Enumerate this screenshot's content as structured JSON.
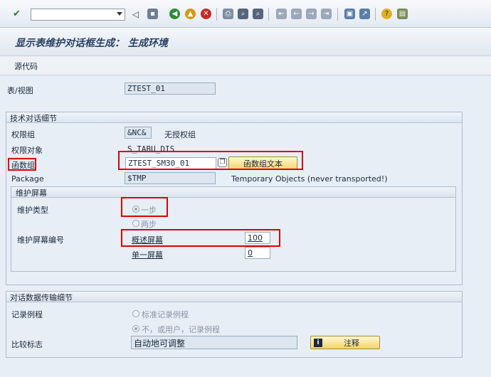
{
  "toolbar": {
    "command_field_value": "",
    "icons": [
      "enter-check-icon",
      "command-field",
      "save-icon",
      "back-icon",
      "exit-icon",
      "cancel-icon",
      "print-icon",
      "find-icon",
      "find-next-icon",
      "first-page-icon",
      "previous-page-icon",
      "next-page-icon",
      "last-page-icon",
      "create-session-icon",
      "create-shortcut-icon",
      "help-icon",
      "customize-layout-icon"
    ]
  },
  "title": "显示表维护对话框生成： 生成环境",
  "subtoolbar": {
    "source_code": "源代码"
  },
  "table_view": {
    "label": "表/视图",
    "value": "ZTEST_01"
  },
  "tech_details": {
    "header": "技术对话细节",
    "auth_group_label": "权限组",
    "auth_group_value": "&NC&",
    "auth_group_desc": "无授权组",
    "auth_object_label": "权限对象",
    "auth_object_value": "S_TABU_DIS",
    "function_group_label": "函数组",
    "function_group_value": "ZTEST_SM30_01",
    "function_group_text_button": "函数组文本",
    "package_label": "Package",
    "package_value": "$TMP",
    "package_desc": "Temporary Objects (never transported!)"
  },
  "maint_screen": {
    "header": "维护屏幕",
    "type_label": "维护类型",
    "one_step": "一步",
    "two_step": "两步",
    "screen_no_label": "维护屏幕编号",
    "overview_label": "概述屏幕",
    "overview_value": "100",
    "single_label": "单一屏幕",
    "single_value": "0"
  },
  "transport": {
    "header": "对话数据传输细节",
    "record_routine_label": "记录例程",
    "std_routine": "标准记录例程",
    "no_user_routine": "不，或用户，记录例程",
    "compare_flag_label": "比较标志",
    "compare_flag_value": "自动地可调整",
    "comment_button": "注释"
  }
}
